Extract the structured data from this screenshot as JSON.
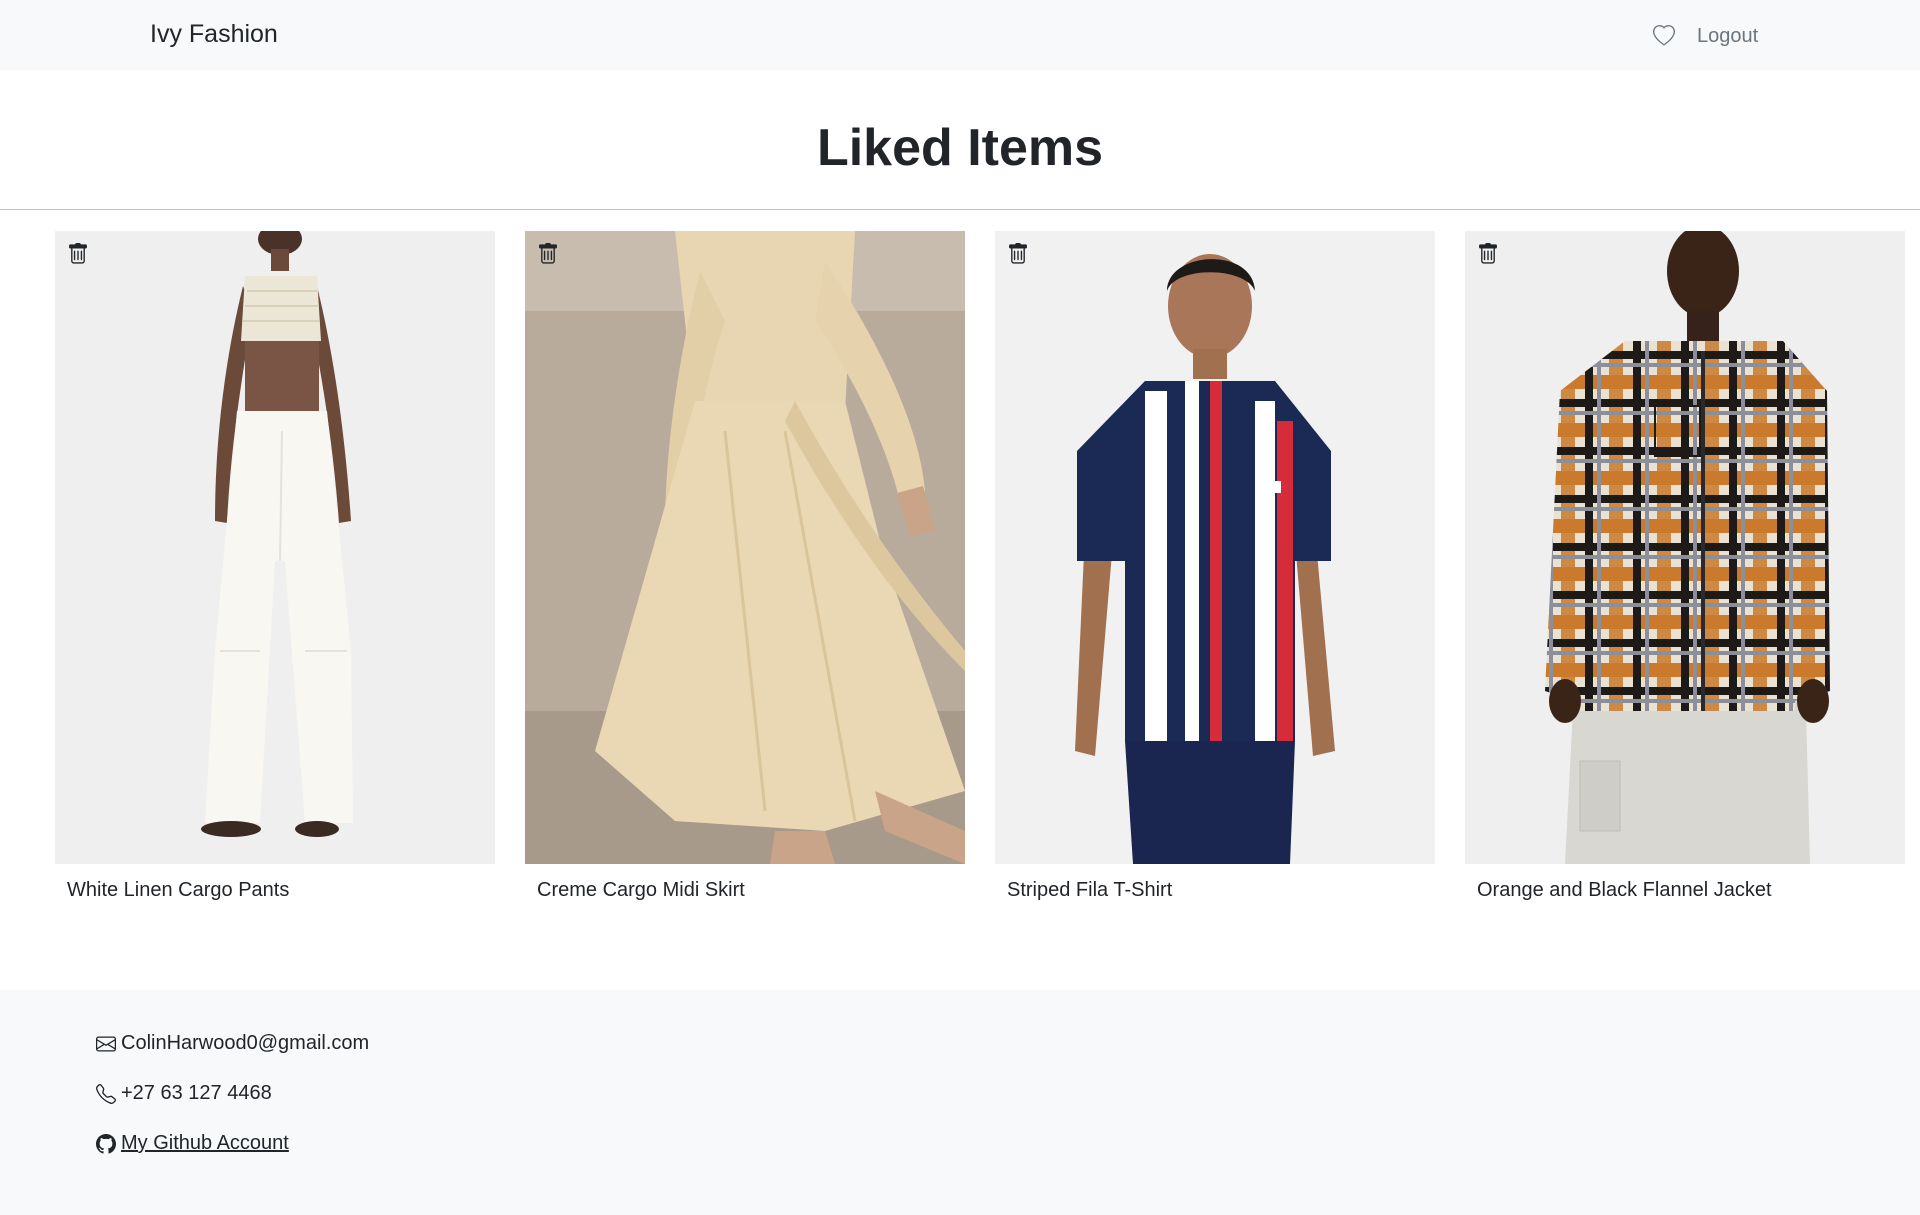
{
  "navbar": {
    "brand": "Ivy Fashion",
    "heart_icon": "heart-icon",
    "logout_label": "Logout"
  },
  "page": {
    "title": "Liked Items"
  },
  "items": [
    {
      "name": "White Linen Cargo Pants",
      "icon": "trash-icon"
    },
    {
      "name": "Creme Cargo Midi Skirt",
      "icon": "trash-icon"
    },
    {
      "name": "Striped Fila T-Shirt",
      "icon": "trash-icon"
    },
    {
      "name": "Orange and Black Flannel Jacket",
      "icon": "trash-icon"
    }
  ],
  "footer": {
    "email": "ColinHarwood0@gmail.com",
    "phone": "+27 63 127 4468",
    "github_label": "My Github Account",
    "email_icon": "envelope-icon",
    "phone_icon": "phone-icon",
    "github_icon": "github-icon"
  },
  "colors": {
    "navbar_bg": "#f8f9fa",
    "footer_bg": "#f8f9fa",
    "text": "#212529",
    "muted": "#6c757d"
  }
}
